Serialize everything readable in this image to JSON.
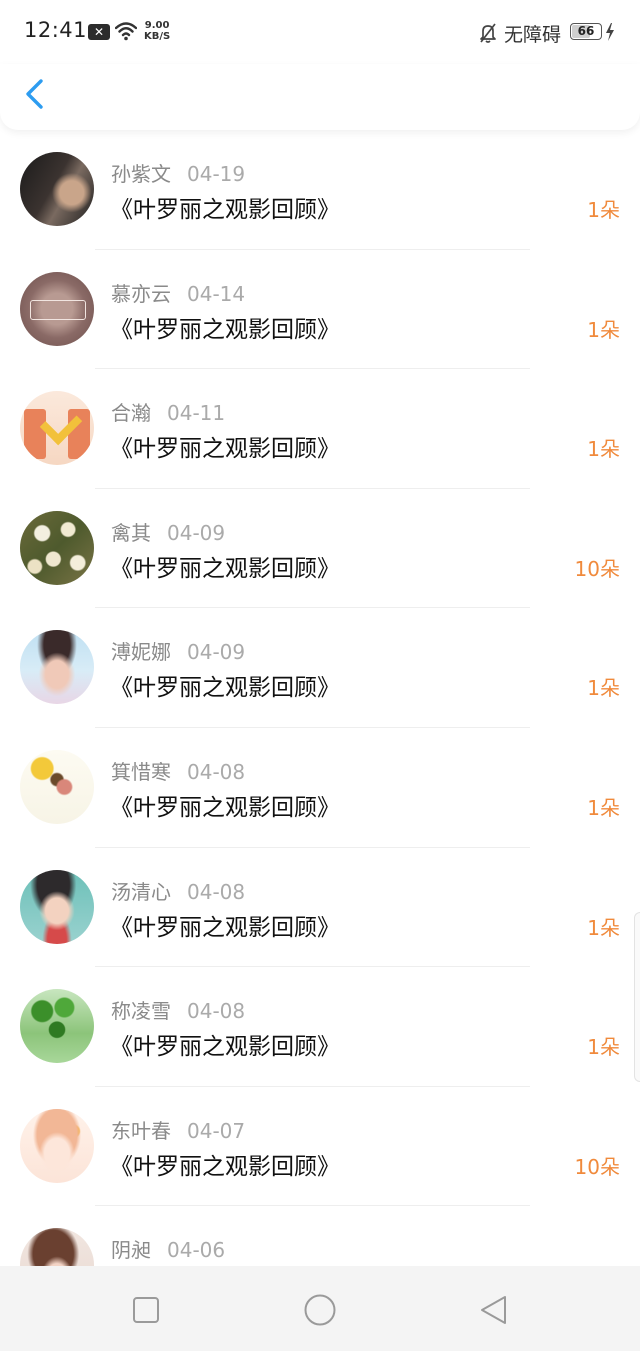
{
  "status_bar": {
    "time": "12:41",
    "speed_value": "9.00",
    "speed_unit": "KB/S",
    "accessibility_label": "无障碍",
    "battery_level": "66",
    "battery_fraction": 0.66
  },
  "colors": {
    "accent_back": "#2d9cf0",
    "flower_count": "#f08a3c",
    "name_gray": "#8a8a8a",
    "title_black": "#111111"
  },
  "list": [
    {
      "name": "孙紫文",
      "date": "04-19",
      "title": "《叶罗丽之观影回顾》",
      "count": "1朵",
      "avatar": "dark-photo"
    },
    {
      "name": "慕亦云",
      "date": "04-14",
      "title": "《叶罗丽之观影回顾》",
      "count": "1朵",
      "avatar": "sepia-badge"
    },
    {
      "name": "合瀚",
      "date": "04-11",
      "title": "《叶罗丽之观影回顾》",
      "count": "1朵",
      "avatar": "orange-cartoon"
    },
    {
      "name": "禽其",
      "date": "04-09",
      "title": "《叶罗丽之观影回顾》",
      "count": "10朵",
      "avatar": "flowers"
    },
    {
      "name": "溥妮娜",
      "date": "04-09",
      "title": "《叶罗丽之观影回顾》",
      "count": "1朵",
      "avatar": "blue-portrait"
    },
    {
      "name": "箕惜寒",
      "date": "04-08",
      "title": "《叶罗丽之观影回顾》",
      "count": "1朵",
      "avatar": "sunflower-girl"
    },
    {
      "name": "汤清心",
      "date": "04-08",
      "title": "《叶罗丽之观影回顾》",
      "count": "1朵",
      "avatar": "boy-photo"
    },
    {
      "name": "称凌雪",
      "date": "04-08",
      "title": "《叶罗丽之观影回顾》",
      "count": "1朵",
      "avatar": "plant-glass"
    },
    {
      "name": "东叶春",
      "date": "04-07",
      "title": "《叶罗丽之观影回顾》",
      "count": "10朵",
      "avatar": "anime-girl"
    },
    {
      "name": "阴昶",
      "date": "04-06",
      "title": "",
      "count": "",
      "avatar": "partial-portrait"
    }
  ],
  "icons": {
    "back": "chevron-left-icon",
    "nav_recent": "square-icon",
    "nav_home": "circle-icon",
    "nav_back": "triangle-back-icon"
  }
}
